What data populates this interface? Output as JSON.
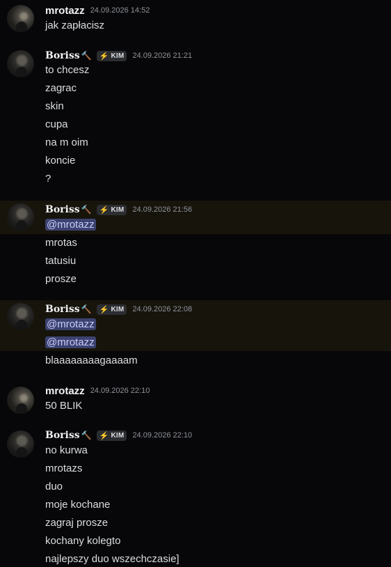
{
  "messages": [
    {
      "author": "mrotazz",
      "timestamp": "24.09.2026 14:52",
      "lines": [
        "jak zapłacisz"
      ]
    },
    {
      "author": "Boriss",
      "author_icon": "hammer-icon",
      "tag": "KIM",
      "timestamp": "24.09.2026 21:21",
      "lines": [
        "to chcesz",
        "zagrac",
        "skin",
        "cupa",
        "na m oim",
        "koncie",
        "?"
      ]
    },
    {
      "author": "Boriss",
      "author_icon": "hammer-icon",
      "tag": "KIM",
      "timestamp": "24.09.2026 21:56",
      "mentions": [
        "@mrotazz"
      ],
      "lines": [
        "mrotas",
        "tatusiu",
        "prosze"
      ]
    },
    {
      "author": "Boriss",
      "author_icon": "hammer-icon",
      "tag": "KIM",
      "timestamp": "24.09.2026 22:08",
      "mentions": [
        "@mrotazz",
        "@mrotazz"
      ],
      "lines": [
        "blaaaaaaaagaaaam"
      ]
    },
    {
      "author": "mrotazz",
      "timestamp": "24.09.2026 22:10",
      "lines": [
        "50 BLIK"
      ]
    },
    {
      "author": "Boriss",
      "author_icon": "hammer-icon",
      "tag": "KIM",
      "timestamp": "24.09.2026 22:10",
      "lines": [
        "no kurwa",
        "mrotazs",
        "duo",
        "moje kochane",
        "zagraj prosze",
        "kochany kolegto",
        "najlepszy duo wszechczasie]"
      ]
    }
  ],
  "colors": {
    "background": "#070709",
    "mention_highlight": "#17140c",
    "mention_pill": "#3c4270",
    "tag_bolt": "#4ea7ff"
  }
}
